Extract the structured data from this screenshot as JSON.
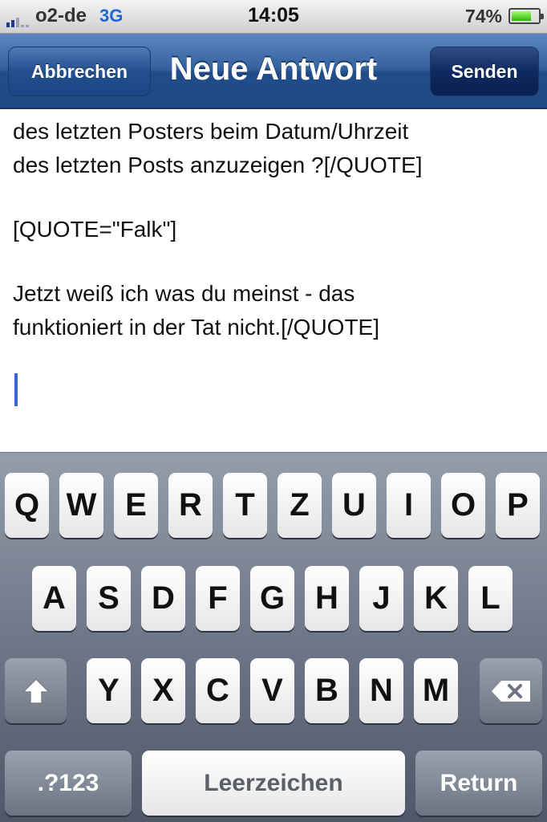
{
  "status_bar": {
    "carrier": "o2-de",
    "network": "3G",
    "time": "14:05",
    "battery_percent": "74%",
    "battery_level": 0.74,
    "signal_bars": 2
  },
  "nav": {
    "title": "Neue Antwort",
    "cancel_label": "Abbrechen",
    "send_label": "Senden"
  },
  "editor": {
    "lines": [
      "des letzten Posters beim Datum/Uhrzeit",
      "des letzten Posts anzuzeigen ?[/QUOTE]",
      "[QUOTE=\"Falk\"]",
      "Jetzt weiß ich was du meinst - das",
      "funktioniert in der Tat nicht.[/QUOTE]"
    ]
  },
  "keyboard": {
    "row1": [
      "Q",
      "W",
      "E",
      "R",
      "T",
      "Z",
      "U",
      "I",
      "O",
      "P"
    ],
    "row2": [
      "A",
      "S",
      "D",
      "F",
      "G",
      "H",
      "J",
      "K",
      "L"
    ],
    "row3": [
      "Y",
      "X",
      "C",
      "V",
      "B",
      "N",
      "M"
    ],
    "numbers_label": ".?123",
    "space_label": "Leerzeichen",
    "return_label": "Return",
    "shift_icon": "shift-arrow-icon",
    "delete_icon": "backspace-icon"
  },
  "colors": {
    "nav_blue": "#2a5796",
    "network_blue": "#1f66d6",
    "cursor_blue": "#3b62d6",
    "battery_green": "#4ccf22"
  }
}
